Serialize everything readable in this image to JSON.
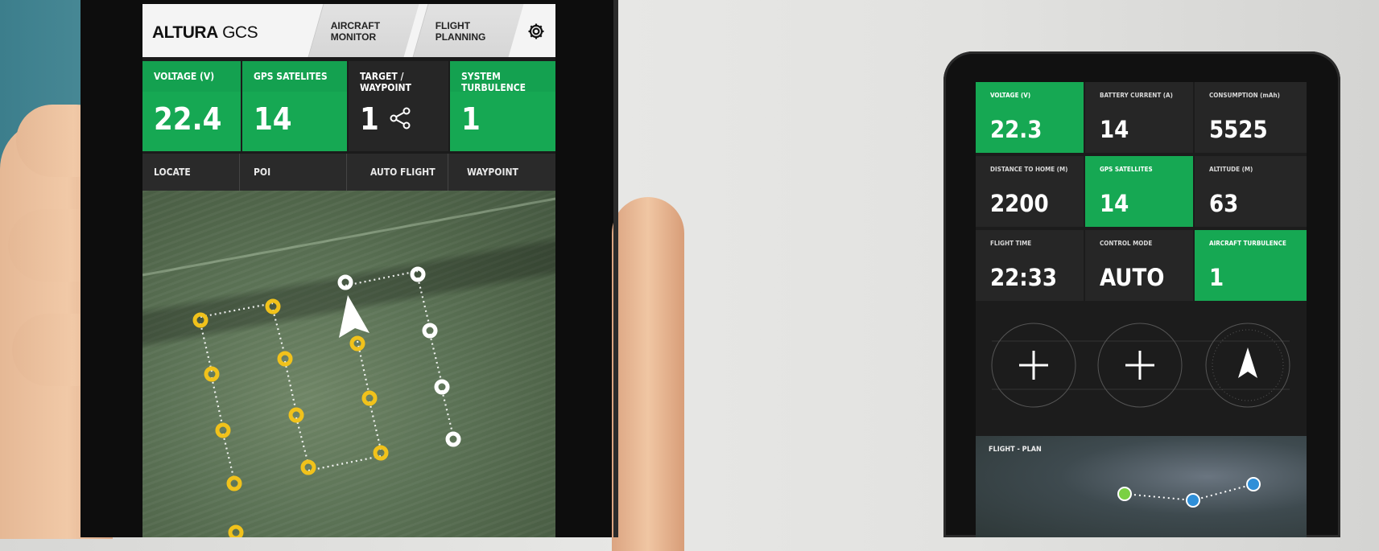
{
  "tablet": {
    "logo_bold": "ALTURA",
    "logo_rest": " GCS",
    "tabs": [
      {
        "label": "AIRCRAFT\nMONITOR"
      },
      {
        "label": "FLIGHT\nPLANNING"
      }
    ],
    "stats": [
      {
        "label": "VOLTAGE (V)",
        "value": "22.4"
      },
      {
        "label": "GPS SATELITES",
        "value": "14"
      },
      {
        "label": "TARGET / WAYPOINT",
        "value": "1"
      },
      {
        "label": "SYSTEM TURBULENCE",
        "value": "1"
      }
    ],
    "actions": [
      {
        "label": "LOCATE"
      },
      {
        "label": "POI"
      },
      {
        "label": "AUTO FLIGHT"
      },
      {
        "label": "WAYPOINT"
      }
    ]
  },
  "phone": {
    "stats": [
      {
        "label": "VOLTAGE (V)",
        "value": "22.3"
      },
      {
        "label": "BATTERY CURRENT (A)",
        "value": "14"
      },
      {
        "label": "CONSUMPTION (mAh)",
        "value": "5525"
      },
      {
        "label": "DISTANCE TO HOME (M)",
        "value": "2200"
      },
      {
        "label": "GPS SATELLITES",
        "value": "14"
      },
      {
        "label": "ALTITUDE (M)",
        "value": "63"
      },
      {
        "label": "FLIGHT TIME",
        "value": "22:33"
      },
      {
        "label": "CONTROL MODE",
        "value": "AUTO"
      },
      {
        "label": "AIRCRAFT TURBULENCE",
        "value": "1"
      }
    ],
    "flight_plan_title": "FLIGHT - PLAN"
  },
  "colors": {
    "accent_green": "#16a853",
    "waypoint_yellow": "#f1c21b",
    "waypoint_white": "#ffffff",
    "marker_blue": "#2f8fd8",
    "marker_green": "#7bd043"
  },
  "icons": [
    "settings-gear-icon",
    "share-icon",
    "aircraft-arrow-icon",
    "crosshair-icon",
    "compass-icon",
    "map-pin-icon"
  ]
}
